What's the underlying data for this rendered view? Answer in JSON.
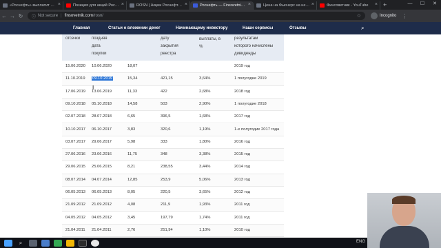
{
  "browser": {
    "tabs": [
      {
        "label": "«Роснефть» выплатит рекорд",
        "favicon_color": "#6b7280"
      },
      {
        "label": "Позиция для акций Роснефть",
        "favicon_color": "#ff0000"
      },
      {
        "label": "ROSN | Акции Роснефть - Ф",
        "favicon_color": "#6b7280"
      },
      {
        "label": "Роснефть — Finsovetnik.com",
        "favicon_color": "#3b5bdb",
        "active": true
      },
      {
        "label": "Цена на Фьючерс на нефть",
        "favicon_color": "#6b7280"
      },
      {
        "label": "Финсоветник - YouTube",
        "favicon_color": "#ff0000"
      }
    ],
    "address": {
      "security": "Not secure",
      "domain": "finsovetnik.com",
      "path": "/rosn/"
    },
    "profile_label": "Incognito"
  },
  "site_nav": {
    "items": [
      "Главная",
      "Статьи о вложении денег",
      "Начинающему инвестору",
      "Наши сервисы",
      "Отзывы"
    ]
  },
  "table": {
    "headers": [
      [
        "отсечки"
      ],
      [
        "поздняя",
        "дата",
        "покупки"
      ],
      [],
      [
        "дату",
        "закрытия",
        "реестра"
      ],
      [
        "выплаты, в",
        "%"
      ],
      [
        "результатам",
        "которого начислены",
        "дивиденды"
      ]
    ],
    "rows": [
      [
        "15.06.2020",
        "10.06.2020",
        "18,07",
        "",
        "",
        "2019 год"
      ],
      [
        "11.10.2019",
        "09.10.2019",
        "15,34",
        "421,15",
        "3,64%",
        "1 полугодие 2019"
      ],
      [
        "17.06.2019",
        "13.06.2019",
        "11,33",
        "422",
        "2,68%",
        "2018 год"
      ],
      [
        "09.10.2018",
        "05.10.2018",
        "14,58",
        "503",
        "2,90%",
        "1 полугодие 2018"
      ],
      [
        "02.07.2018",
        "28.07.2018",
        "6,65",
        "396,5",
        "1,68%",
        "2017 год"
      ],
      [
        "10.10.2017",
        "06.10.2017",
        "3,83",
        "320,6",
        "1,19%",
        "1-е полугодие 2017 года"
      ],
      [
        "03.07.2017",
        "29.06.2017",
        "5,98",
        "333",
        "1,80%",
        "2016 год"
      ],
      [
        "27.06.2016",
        "23.06.2016",
        "11,75",
        "348",
        "3,38%",
        "2015 год"
      ],
      [
        "29.06.2015",
        "25.06.2015",
        "8,21",
        "238,55",
        "3,44%",
        "2014 год"
      ],
      [
        "08.07.2014",
        "04.07.2014",
        "12,85",
        "253,9",
        "5,06%",
        "2013 год"
      ],
      [
        "06.05.2013",
        "06.05.2013",
        "8,05",
        "220,5",
        "3,65%",
        "2012 год"
      ],
      [
        "21.09.2012",
        "21.09.2012",
        "4,08",
        "211,9",
        "1,93%",
        "2011 год"
      ],
      [
        "04.05.2012",
        "04.05.2012",
        "3,45",
        "197,79",
        "1,74%",
        "2011 год"
      ],
      [
        "21.04.2011",
        "21.04.2011",
        "2,76",
        "251,94",
        "1,10%",
        "2010 год"
      ]
    ],
    "highlighted_cell": {
      "row": 1,
      "col": 1
    }
  },
  "taskbar": {
    "tray_text": "ENG"
  }
}
